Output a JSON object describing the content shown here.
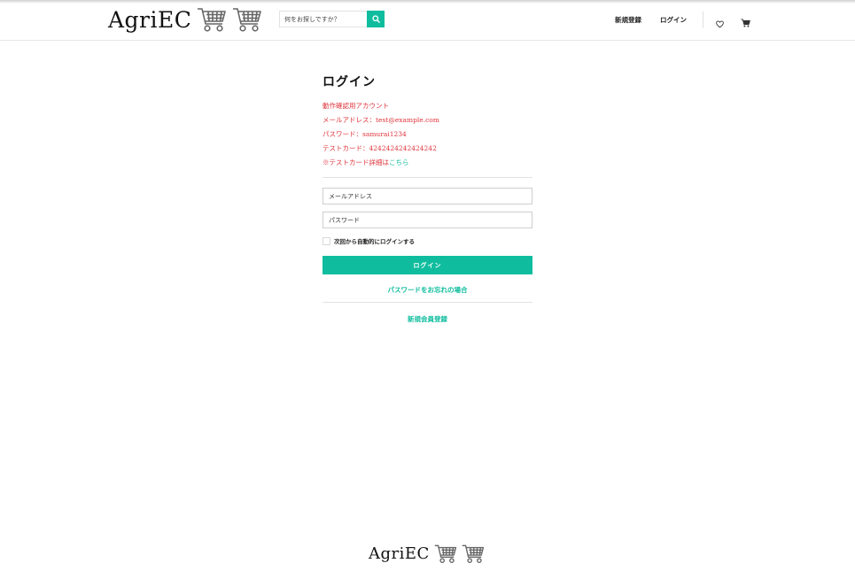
{
  "header": {
    "brand": "AgriEC",
    "search": {
      "placeholder": "何をお探しですか？"
    },
    "nav": {
      "signup": "新規登録",
      "login": "ログイン"
    },
    "icons": {
      "search": "search-icon",
      "wishlist": "heart-icon",
      "cart": "cart-icon",
      "logo": "shopping-cart-logo-icon"
    }
  },
  "login": {
    "title": "ログイン",
    "test_account": {
      "heading": "動作確認用アカウント",
      "email": "メールアドレス：test@example.com",
      "password": "パスワード：samurai1234",
      "card": "テストカード：4242424242424242",
      "card_detail_prefix": "※テストカード詳細は",
      "card_detail_link": "こちら"
    },
    "email_placeholder": "メールアドレス",
    "password_placeholder": "パスワード",
    "remember_label": "次回から自動的にログインする",
    "submit_label": "ログイン",
    "forgot_password": "パスワードをお忘れの場合",
    "register": "新規会員登録"
  },
  "footer": {
    "brand": "AgriEC"
  },
  "colors": {
    "accent": "#0fbd9e",
    "notice": "#e0343b",
    "text": "#222222"
  }
}
